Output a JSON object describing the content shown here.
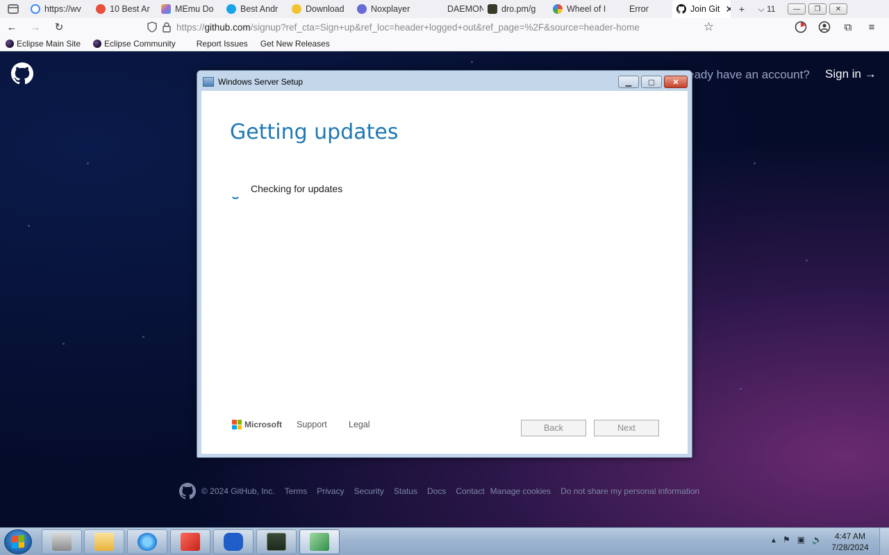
{
  "browser": {
    "tabs": [
      {
        "label": "https://wv",
        "icon": "google-icon",
        "color": "#4285f4"
      },
      {
        "label": "10 Best Ar",
        "icon": "site-icon",
        "color": "#e94f3b"
      },
      {
        "label": "MEmu Do",
        "icon": "memu-icon",
        "color": "#a06ad6"
      },
      {
        "label": "Best Andr",
        "icon": "m-icon",
        "color": "#1aa3e8"
      },
      {
        "label": "Download",
        "icon": "download-icon",
        "color": "#f2c230"
      },
      {
        "label": "Noxplayer",
        "icon": "nox-icon",
        "color": "#6a6ad6"
      },
      {
        "label": "DAEMON",
        "icon": "daemon-icon",
        "color": "#f0f0f4"
      },
      {
        "label": "dro.pm/g",
        "icon": "terminal-icon",
        "color": "#3a3a2a"
      },
      {
        "label": "Wheel of I",
        "icon": "wheel-icon",
        "color": "#e04e3b"
      },
      {
        "label": "Error",
        "icon": "error-icon",
        "color": "#f0f0f4"
      },
      {
        "label": "Join Git",
        "icon": "github-icon",
        "color": "#111111",
        "active": true
      }
    ],
    "tab_count": "11",
    "url_prefix": "https://",
    "url_domain": "github.com",
    "url_rest": "/signup?ref_cta=Sign+up&ref_loc=header+logged+out&ref_page=%2F&source=header-home",
    "bookmarks": [
      "Eclipse Main Site",
      "Eclipse Community",
      "Report Issues",
      "Get New Releases"
    ]
  },
  "github": {
    "signin_prompt": "eady have an account?",
    "signin_link": "Sign in →",
    "footer": [
      "© 2024 GitHub, Inc.",
      "Terms",
      "Privacy",
      "Security",
      "Status",
      "Docs",
      "Contact",
      "Manage cookies",
      "Do not share my personal information"
    ]
  },
  "dialog": {
    "title": "Windows Server Setup",
    "heading": "Getting updates",
    "status": "Checking for updates",
    "brand": "Microsoft",
    "support": "Support",
    "legal": "Legal",
    "back": "Back",
    "next": "Next",
    "accent": "#1e78b4"
  },
  "taskbar": {
    "time": "4:47 AM",
    "date": "7/28/2024"
  }
}
